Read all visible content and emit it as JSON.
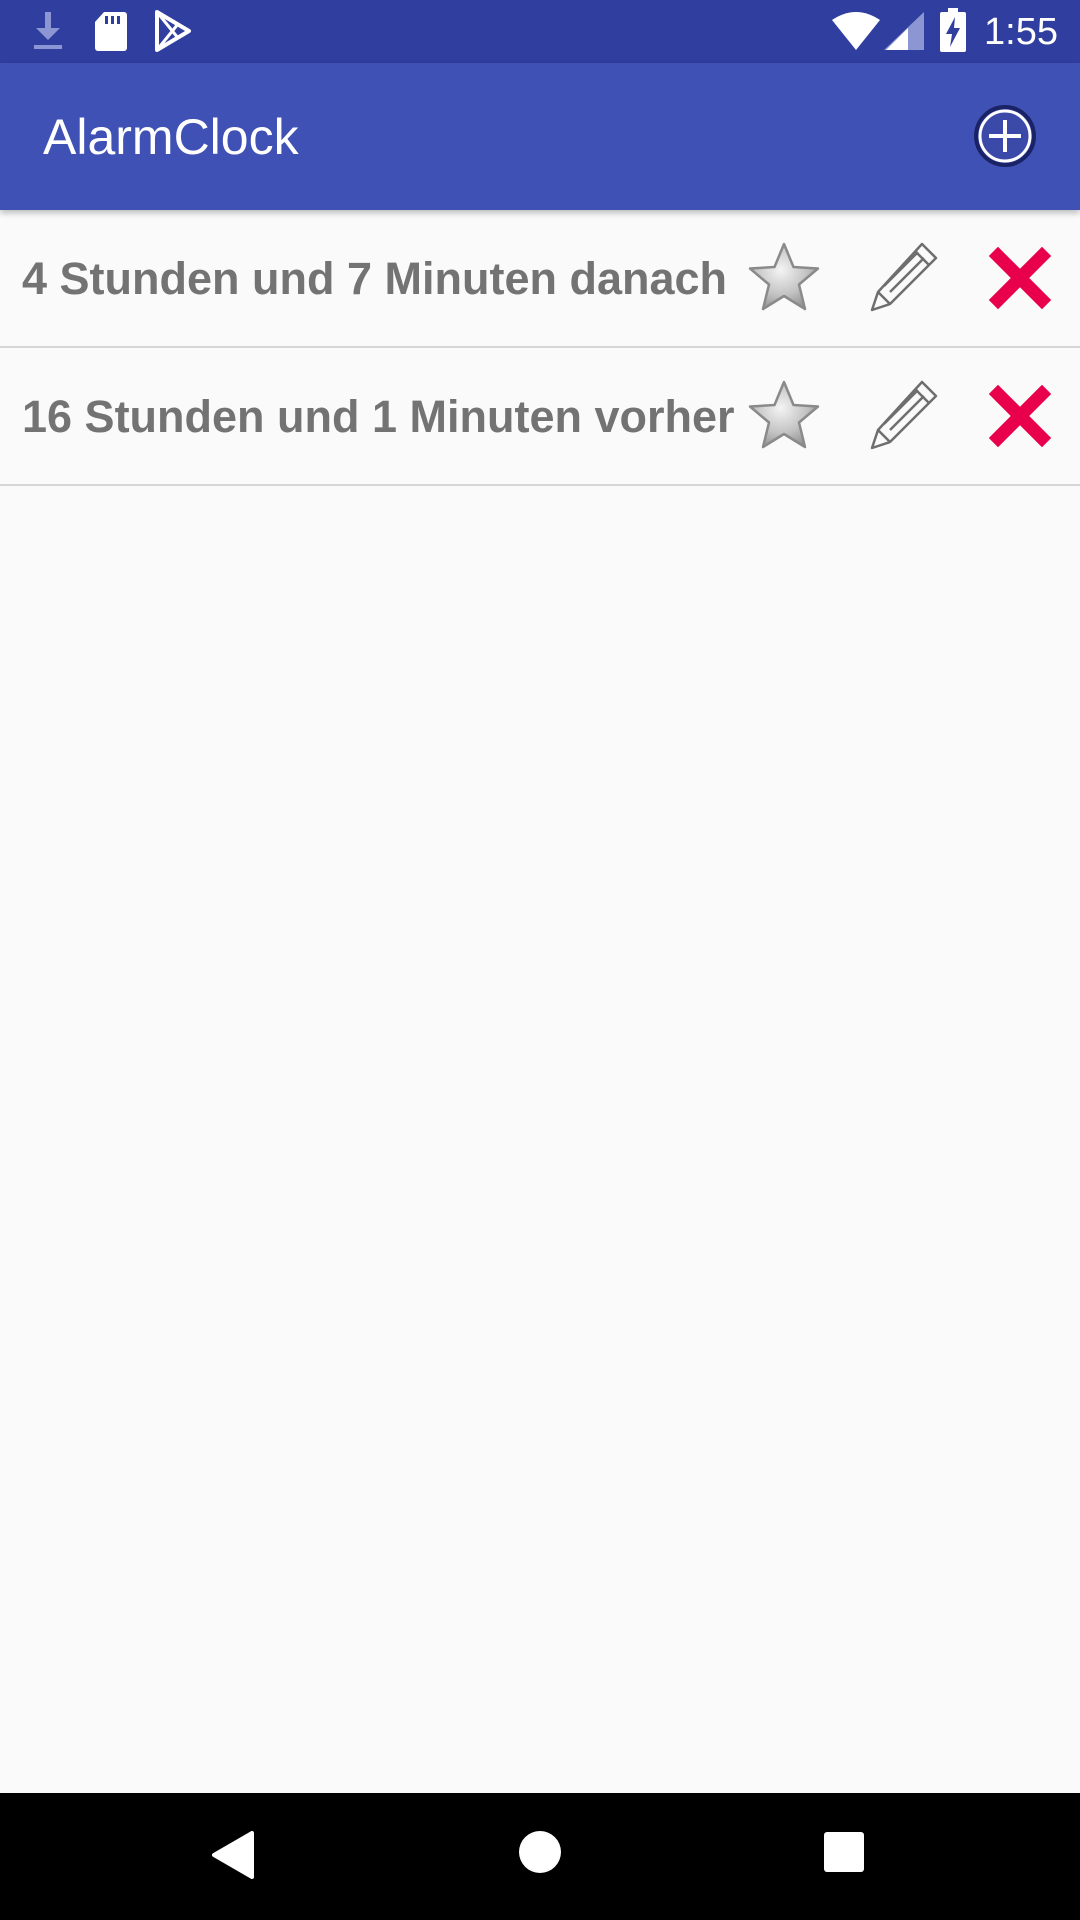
{
  "status_bar": {
    "time": "1:55",
    "left_icons": [
      "download-icon",
      "sd-card-icon",
      "play-store-icon"
    ],
    "right_icons": [
      "wifi-icon",
      "cell-signal-icon",
      "battery-charging-icon"
    ]
  },
  "app_bar": {
    "title": "AlarmClock",
    "action_icon": "add-circle-icon"
  },
  "alarms": [
    {
      "label": "4 Stunden und 7 Minuten danach",
      "icons": [
        "star-icon",
        "pencil-icon",
        "close-icon"
      ]
    },
    {
      "label": "16 Stunden und 1 Minuten vorher",
      "icons": [
        "star-icon",
        "pencil-icon",
        "close-icon"
      ]
    }
  ],
  "nav_bar": {
    "buttons": [
      "back-icon",
      "home-icon",
      "recents-icon"
    ]
  },
  "colors": {
    "status_bar": "#303f9f",
    "app_bar": "#3f51b5",
    "background": "#fafafa",
    "item_text": "#737373",
    "delete": "#e8004c",
    "divider": "#d6d6d6"
  }
}
